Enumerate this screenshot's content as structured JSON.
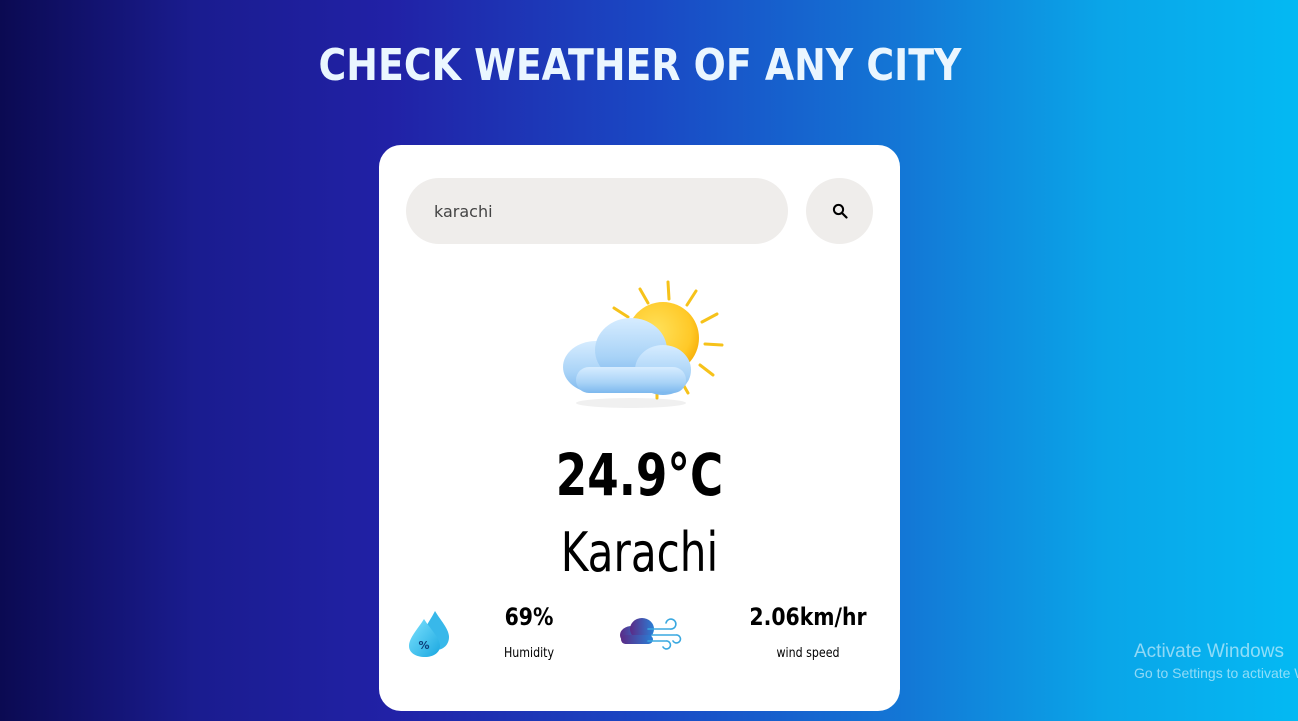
{
  "header": {
    "title": "CHECK WEATHER OF ANY CITY"
  },
  "search": {
    "value": "karachi",
    "icon": "search-icon"
  },
  "weather": {
    "icon": "partly-cloudy-icon",
    "temperature": "24.9°C",
    "city": "Karachi"
  },
  "details": {
    "humidity": {
      "icon": "humidity-icon",
      "value": "69%",
      "label": "Humidity"
    },
    "wind": {
      "icon": "wind-icon",
      "value": "2.06km/hr",
      "label": "wind speed"
    }
  },
  "watermark": {
    "title": "Activate Windows",
    "subtitle": "Go to Settings to activate Windows."
  },
  "colors": {
    "gradient_start": "#0b0a52",
    "gradient_mid": "#2121a6",
    "gradient_end": "#04b9f3",
    "card": "#ffffff",
    "input_bg": "#efedeb"
  }
}
